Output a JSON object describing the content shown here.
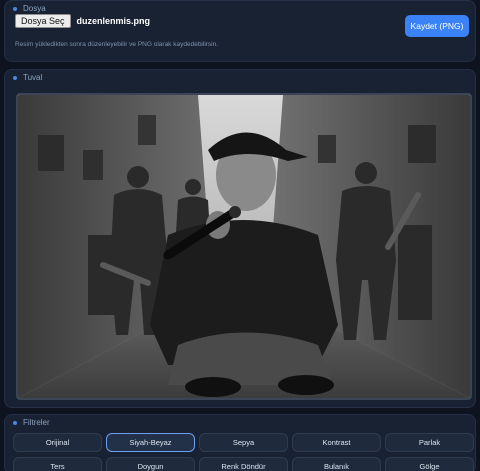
{
  "file_section": {
    "title": "Dosya",
    "choose_button": "Dosya Seç",
    "file_name": "duzenlenmis.png",
    "hint": "Resim yükledikten sonra düzenleyebilir ve PNG olarak kaydedebilirsin.",
    "save_button": "Kaydet (PNG)"
  },
  "canvas_section": {
    "title": "Tuval"
  },
  "filters_section": {
    "title": "Filtreler",
    "active": "Siyah-Beyaz",
    "items": [
      "Orijinal",
      "Siyah-Beyaz",
      "Sepya",
      "Kontrast",
      "Parlak",
      "Ters",
      "Doygun",
      "Renk Döndür",
      "Bulanık",
      "Gölge"
    ]
  },
  "colors": {
    "accent": "#3b82f6",
    "background": "#0d1420",
    "panel": "#182232"
  }
}
